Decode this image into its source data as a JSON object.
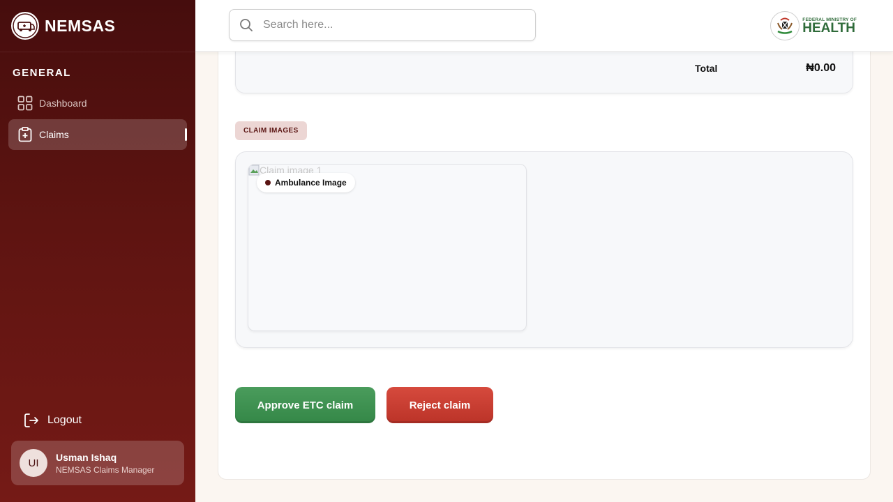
{
  "brand": {
    "name": "NEMSAS"
  },
  "sidebar": {
    "section_label": "GENERAL",
    "items": [
      {
        "label": "Dashboard",
        "icon": "grid-icon"
      },
      {
        "label": "Claims",
        "icon": "clipboard-plus-icon",
        "active": true
      }
    ],
    "logout_label": "Logout"
  },
  "user": {
    "initials": "UI",
    "name": "Usman Ishaq",
    "role": "NEMSAS Claims Manager"
  },
  "search": {
    "placeholder": "Search here..."
  },
  "ministry": {
    "small": "FEDERAL MINISTRY OF",
    "big": "HEALTH"
  },
  "summary": {
    "total_label": "Total",
    "total_value": "₦0.00"
  },
  "claim_images": {
    "section_label": "CLAIM IMAGES",
    "images": [
      {
        "label": "Ambulance Image",
        "alt": "Claim image 1"
      }
    ]
  },
  "actions": {
    "approve_label": "Approve ETC claim",
    "reject_label": "Reject claim"
  },
  "colors": {
    "sidebar": "#5e1411",
    "approve": "#3e9150",
    "reject": "#c83c30",
    "badge_bg": "#ecd6d4"
  }
}
